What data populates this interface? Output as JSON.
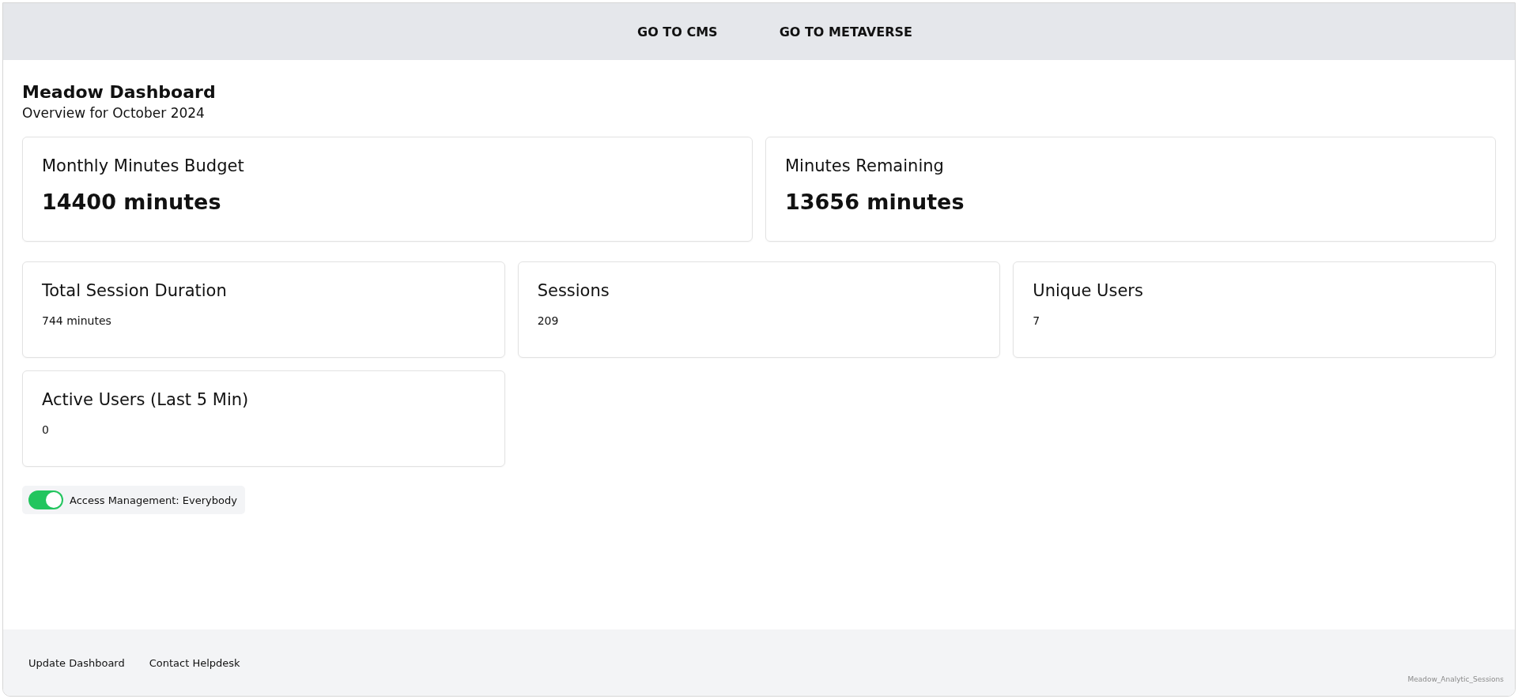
{
  "nav": {
    "links": [
      "GO TO CMS",
      "GO TO METAVERSE"
    ]
  },
  "header": {
    "title": "Meadow Dashboard",
    "subtitle": "Overview for October 2024"
  },
  "primary_stats": [
    {
      "label": "Monthly Minutes Budget",
      "value": "14400 minutes"
    },
    {
      "label": "Minutes Remaining",
      "value": "13656 minutes"
    }
  ],
  "stats": [
    {
      "label": "Total Session Duration",
      "value": "744 minutes"
    },
    {
      "label": "Sessions",
      "value": "209"
    },
    {
      "label": "Unique Users",
      "value": "7"
    },
    {
      "label": "Active Users (Last 5 Min)",
      "value": "0"
    }
  ],
  "access_toggle": {
    "label": "Access Management: Everybody",
    "on": true
  },
  "footer": {
    "links": [
      "Update Dashboard",
      "Contact Helpdesk"
    ],
    "caption": "Meadow_Analytic_Sessions"
  }
}
